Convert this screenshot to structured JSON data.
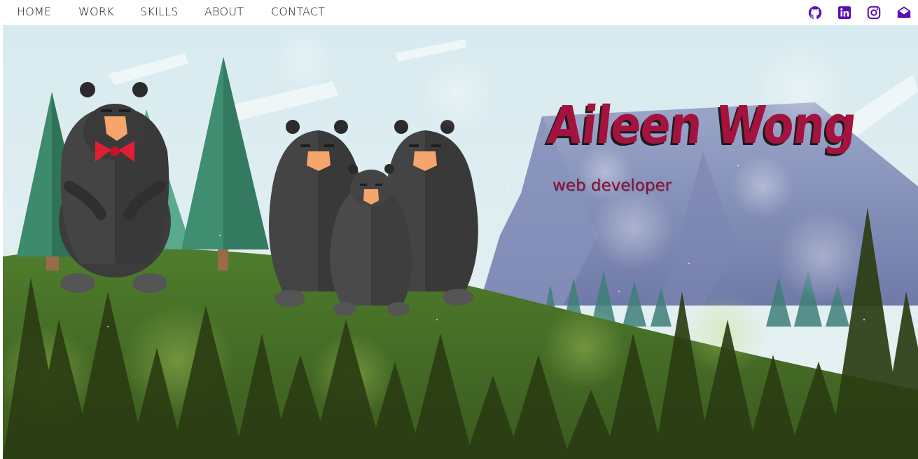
{
  "nav": {
    "items": [
      {
        "label": "HOME"
      },
      {
        "label": "WORK"
      },
      {
        "label": "SKILLS"
      },
      {
        "label": "ABOUT"
      },
      {
        "label": "CONTACT"
      }
    ]
  },
  "social": {
    "icons": [
      "github-icon",
      "linkedin-icon",
      "instagram-icon",
      "email-icon"
    ],
    "accent_color": "#5b0fb4"
  },
  "hero": {
    "title": "Aileen Wong",
    "subtitle": "web developer",
    "title_color": "#a3133e",
    "subtitle_color": "#8a0f32"
  },
  "illustration": {
    "bears": [
      "bear-with-bowtie",
      "bear-adult-left",
      "bear-cub",
      "bear-adult-right"
    ],
    "bowtie_color": "#e01f35"
  }
}
